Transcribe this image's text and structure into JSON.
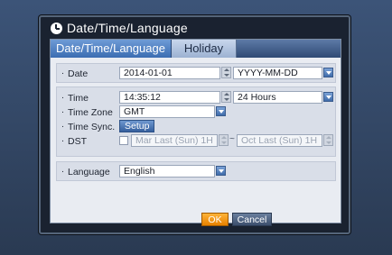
{
  "dialog": {
    "title": "Date/Time/Language",
    "title_icon": "clock-icon"
  },
  "tabs": [
    {
      "label": "Date/Time/Language",
      "active": true
    },
    {
      "label": "Holiday",
      "active": false
    }
  ],
  "date_section": {
    "date_label": "Date",
    "date_value": "2014-01-01",
    "date_format": "YYYY-MM-DD"
  },
  "time_section": {
    "time_label": "Time",
    "time_value": "14:35:12",
    "time_format": "24 Hours",
    "timezone_label": "Time Zone",
    "timezone_value": "GMT",
    "timesync_label": "Time Sync.",
    "setup_button": "Setup",
    "dst_label": "DST",
    "dst_enabled": false,
    "dst_start": "Mar Last (Sun) 1H",
    "dst_separator": "~",
    "dst_end": "Oct Last (Sun) 1H"
  },
  "language_section": {
    "language_label": "Language",
    "language_value": "English"
  },
  "buttons": {
    "ok": "OK",
    "cancel": "Cancel"
  },
  "bullet": "·",
  "colors": {
    "accent_blue": "#3b6db2",
    "ok_orange": "#f29a16",
    "background": "#2e3f55"
  }
}
